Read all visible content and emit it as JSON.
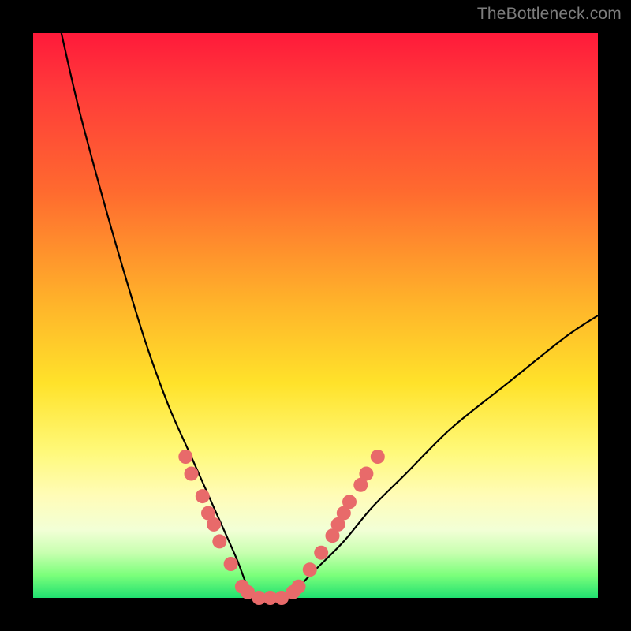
{
  "watermark": "TheBottleneck.com",
  "colors": {
    "background": "#000000",
    "curve_stroke": "#000000",
    "marker_fill": "#e86a6a",
    "marker_stroke": "#b84747"
  },
  "chart_data": {
    "type": "line",
    "title": "",
    "xlabel": "",
    "ylabel": "",
    "xlim": [
      0,
      100
    ],
    "ylim": [
      0,
      100
    ],
    "grid": false,
    "curve": {
      "description": "V-shaped bottleneck curve; x is relative component position, y is bottleneck percentage (0 = no bottleneck). Minimum (y≈0) spans roughly x≈37–45; left arm rises toward 100 as x→5; right arm rises toward ~50 as x→100.",
      "x": [
        5,
        8,
        12,
        16,
        20,
        24,
        28,
        32,
        36,
        38,
        40,
        42,
        44,
        46,
        50,
        55,
        60,
        66,
        74,
        84,
        94,
        100
      ],
      "y": [
        100,
        87,
        72,
        58,
        45,
        34,
        25,
        16,
        7,
        2,
        0,
        0,
        0,
        1,
        5,
        10,
        16,
        22,
        30,
        38,
        46,
        50
      ]
    },
    "markers": {
      "description": "Highlighted sample points clustered on both arms near the valley and along the flat minimum.",
      "points": [
        {
          "x": 27,
          "y": 25
        },
        {
          "x": 28,
          "y": 22
        },
        {
          "x": 30,
          "y": 18
        },
        {
          "x": 31,
          "y": 15
        },
        {
          "x": 32,
          "y": 13
        },
        {
          "x": 33,
          "y": 10
        },
        {
          "x": 35,
          "y": 6
        },
        {
          "x": 37,
          "y": 2
        },
        {
          "x": 38,
          "y": 1
        },
        {
          "x": 40,
          "y": 0
        },
        {
          "x": 42,
          "y": 0
        },
        {
          "x": 44,
          "y": 0
        },
        {
          "x": 46,
          "y": 1
        },
        {
          "x": 47,
          "y": 2
        },
        {
          "x": 49,
          "y": 5
        },
        {
          "x": 51,
          "y": 8
        },
        {
          "x": 53,
          "y": 11
        },
        {
          "x": 54,
          "y": 13
        },
        {
          "x": 55,
          "y": 15
        },
        {
          "x": 56,
          "y": 17
        },
        {
          "x": 58,
          "y": 20
        },
        {
          "x": 59,
          "y": 22
        },
        {
          "x": 61,
          "y": 25
        }
      ]
    }
  }
}
